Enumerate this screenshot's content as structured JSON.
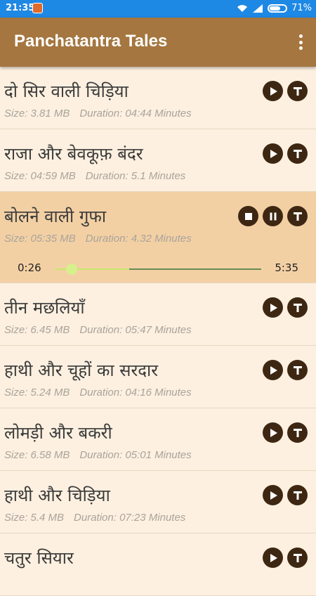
{
  "status_bar": {
    "time": "21:35",
    "battery": "71%",
    "battery_level": 0.71
  },
  "app_bar": {
    "title": "Panchatantra Tales"
  },
  "labels": {
    "size": "Size:",
    "duration": "Duration:",
    "minutes": "Minutes"
  },
  "stories": [
    {
      "title": "दो सिर वाली चिड़िया",
      "size": "3.81 MB",
      "duration": "04:44",
      "playing": false
    },
    {
      "title": "राजा और बेवकूफ़ बंदर",
      "size": "04:59 MB",
      "duration": "5.1",
      "playing": false
    },
    {
      "title": "बोलने वाली गुफा",
      "size": "05:35 MB",
      "duration": "4.32",
      "playing": true
    },
    {
      "title": "तीन मछलियाँ",
      "size": "6.45 MB",
      "duration": "05:47",
      "playing": false
    },
    {
      "title": "हाथी और चूहों का सरदार",
      "size": "5.24 MB",
      "duration": "04:16",
      "playing": false
    },
    {
      "title": "लोमड़ी और बकरी",
      "size": "6.58 MB",
      "duration": "05:01",
      "playing": false
    },
    {
      "title": "हाथी और चिड़िया",
      "size": "5.4 MB",
      "duration": "07:23",
      "playing": false
    },
    {
      "title": "चतुर सियार",
      "size": "",
      "duration": "",
      "playing": false
    }
  ],
  "player": {
    "current": "0:26",
    "total": "5:35",
    "progress": 0.08,
    "buffered": 0.36
  },
  "icons": {
    "play": "play-icon",
    "text": "text-t-icon",
    "stop": "stop-icon",
    "pause": "pause-icon",
    "menu": "overflow-menu-icon"
  },
  "colors": {
    "status_bar": "#1e88e5",
    "app_bar": "#a5763f",
    "row_bg": "#fdf0e0",
    "active_row": "#f3d0a4",
    "button": "#3e2712"
  }
}
